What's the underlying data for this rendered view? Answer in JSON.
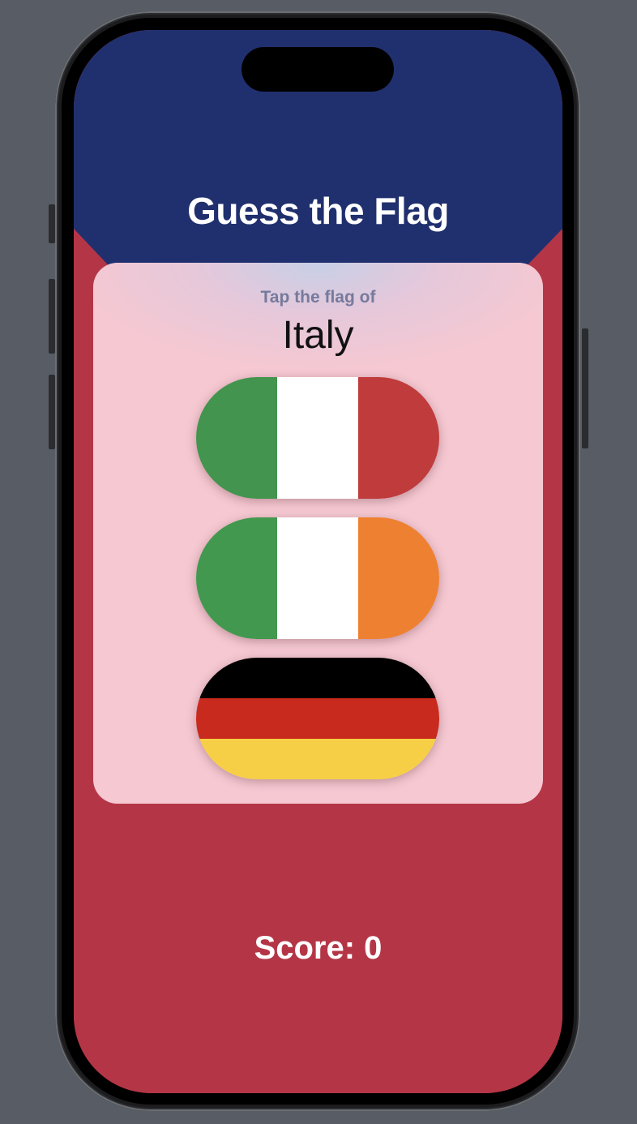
{
  "app": {
    "title": "Guess the Flag",
    "prompt": "Tap the flag of",
    "country": "Italy",
    "score_text": "Score: 0"
  },
  "colors": {
    "background_top": "#20306e",
    "background_bottom": "#b43646",
    "card": "#f5c8d2",
    "prompt_text": "#767a9c"
  },
  "flags": [
    {
      "name": "italy-flag",
      "orientation": "vertical",
      "stripes": [
        "#42944e",
        "#ffffff",
        "#bf3b3c"
      ]
    },
    {
      "name": "ireland-flag",
      "orientation": "vertical",
      "stripes": [
        "#42984f",
        "#ffffff",
        "#ee8031"
      ]
    },
    {
      "name": "germany-flag",
      "orientation": "horizontal",
      "stripes": [
        "#000000",
        "#c82a1e",
        "#f7cf47"
      ]
    }
  ]
}
